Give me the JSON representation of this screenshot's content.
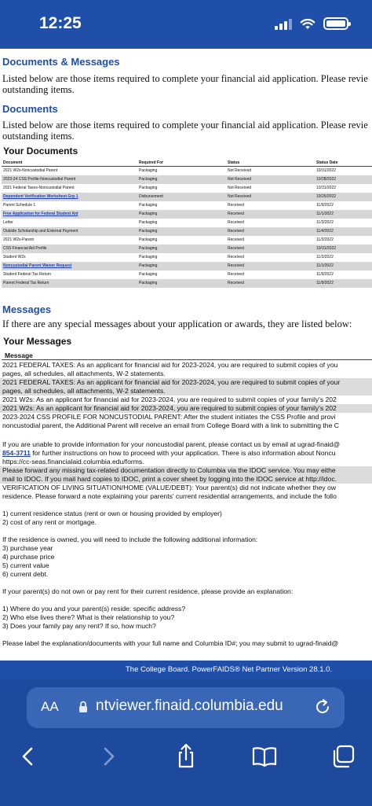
{
  "status_bar": {
    "time": "12:25"
  },
  "documents_messages": {
    "title": "Documents & Messages",
    "text_line1": "Listed below are those items required to complete your financial aid application.  Please revie",
    "text_line2": "outstanding items."
  },
  "documents": {
    "title": "Documents",
    "text_line1": "Listed below are those items required to complete your financial aid application.  Please revie",
    "text_line2": "outstanding items.",
    "your_documents": "Your Documents",
    "columns": [
      "Document",
      "Required For",
      "Status",
      "Status Date"
    ],
    "rows": [
      {
        "document": "2021 W2s-Noncustodial Parent",
        "required_for": "Packaging",
        "status": "Not Received",
        "date": "10/31/2022",
        "link": false
      },
      {
        "document": "2023-24 CSS Profile-Noncustodial Parent",
        "required_for": "Packaging",
        "status": "Not Received",
        "date": "10/28/2022",
        "link": false
      },
      {
        "document": "2021 Federal Taxes-Noncustodial Parent",
        "required_for": "Packaging",
        "status": "Not Received",
        "date": "10/31/2022",
        "link": false
      },
      {
        "document": "Dependent Verification Worksheet Grp 1",
        "required_for": "Disbursement",
        "status": "Not Received",
        "date": "10/25/2022",
        "link": true
      },
      {
        "document": "Parent Schedule 1",
        "required_for": "Packaging",
        "status": "Received",
        "date": "11/9/2022",
        "link": false
      },
      {
        "document": "Free Application for Federal Student Aid",
        "required_for": "Packaging",
        "status": "Received",
        "date": "11/1/2022",
        "link": true
      },
      {
        "document": "Letter",
        "required_for": "Packaging",
        "status": "Received",
        "date": "11/3/2022",
        "link": false
      },
      {
        "document": "Outside Scholarship and External Payment",
        "required_for": "Packaging",
        "status": "Received",
        "date": "11/4/2022",
        "link": false
      },
      {
        "document": "2021 W2s-Parent",
        "required_for": "Packaging",
        "status": "Received",
        "date": "11/3/2022",
        "link": false
      },
      {
        "document": "CSS Financial Aid Profile",
        "required_for": "Packaging",
        "status": "Received",
        "date": "10/31/2022",
        "link": false
      },
      {
        "document": "Student W2s",
        "required_for": "Packaging",
        "status": "Received",
        "date": "11/2/2022",
        "link": false
      },
      {
        "document": "Noncustodial Parent Waiver Request",
        "required_for": "Packaging",
        "status": "Received",
        "date": "11/1/2022",
        "link": true
      },
      {
        "document": "Student Federal Tax Return",
        "required_for": "Packaging",
        "status": "Received",
        "date": "11/9/2022",
        "link": false
      },
      {
        "document": "Parent Federal Tax Return",
        "required_for": "Packaging",
        "status": "Received",
        "date": "11/9/2022",
        "link": false
      }
    ]
  },
  "messages": {
    "title": "Messages",
    "text": "If there are any special messages about your application or awards, they are listed below:",
    "your_messages": "Your Messages",
    "column": "Message",
    "msg1_line1": "2021 FEDERAL TAXES: As an applicant for financial aid for 2023-2024, you are required to submit copies of you",
    "msg1_line2": "pages, all schedules, all attachments, W-2 statements.",
    "msg2_line1": "2021 FEDERAL TAXES: As an applicant for financial aid for 2023-2024, you are required to submit copies of your",
    "msg2_line2": "pages, all schedules, all attachments, W-2 statements.",
    "msg3": "2021 W2s: As an applicant for financial aid for 2023-2024, you are required to submit copies of your family's 202",
    "msg4": "2021 W2s: As an applicant for financial aid for 2023-2024, you are required to submit copies of your family's 202",
    "msg5_line1": "2023-2024 CSS PROFILE FOR NONCUSTODIAL PARENT: After the student initiates the CSS Profile and provi",
    "msg5_line2": "noncustodial parent, the Additional Parent will receive an email from College Board with a link to submitting the C",
    "msg6_line1": "If you are unable to provide information for your noncustodial parent, please contact us by email at ugrad-finaid@",
    "msg6_phone": "854-3711",
    "msg6_line2_rest": " for further instructions on how to proceed with your application. There is also information about Noncu",
    "msg6_line3": "https://cc-seas.financialaid.columbia.edu/forms.",
    "msg7_line1": "Please forward any missing tax-related documentation directly to Columbia via the IDOC service. You may eithe",
    "msg7_line2": "mail to IDOC. If you mail hard copies to IDOC, print a cover sheet by logging into the IDOC service at http://idoc.",
    "msg8_line1": "VERIFICATION OF LIVING SITUATION/HOME (VALUE/DEBT): Your parent(s) did not indicate whether they ow",
    "msg8_line2": "residence. Please forward a note explaining your parents' current residential arrangements, and include the follo",
    "msg8_line4": "1) current residence status (rent or own or housing provided by employer)",
    "msg8_line5": "2) cost of any rent or mortgage.",
    "msg8_line7": "If the residence is owned, you will need to include the following additional information:",
    "msg8_line8": "3) purchase year",
    "msg8_line9": "4) purchase price",
    "msg8_line10": "5) current value",
    "msg8_line11": "6) current debt.",
    "msg8_line13": "If your parent(s) do not own or pay rent for their current residence, please provide an explanation:",
    "msg8_line15": "1) Where do you and your parent(s) reside: specific address?",
    "msg8_line16": "2) Who else lives there? What is their relationship to you?",
    "msg8_line17": "3) Does your family pay any rent? If so, how much?",
    "msg8_line19": "Please label the explanation/documents with your full name and Columbia ID#; you may submit to ugrad-finaid@"
  },
  "footer": {
    "text": "The College Board. PowerFAIDS® Net Partner Version 28.1.0."
  },
  "browser": {
    "aa_label": "AA",
    "url": "ntviewer.finaid.columbia.edu"
  },
  "icons": {
    "back": "chevron-left-icon",
    "forward": "chevron-right-icon",
    "share": "share-icon",
    "bookmarks": "book-icon",
    "tabs": "tabs-icon"
  }
}
